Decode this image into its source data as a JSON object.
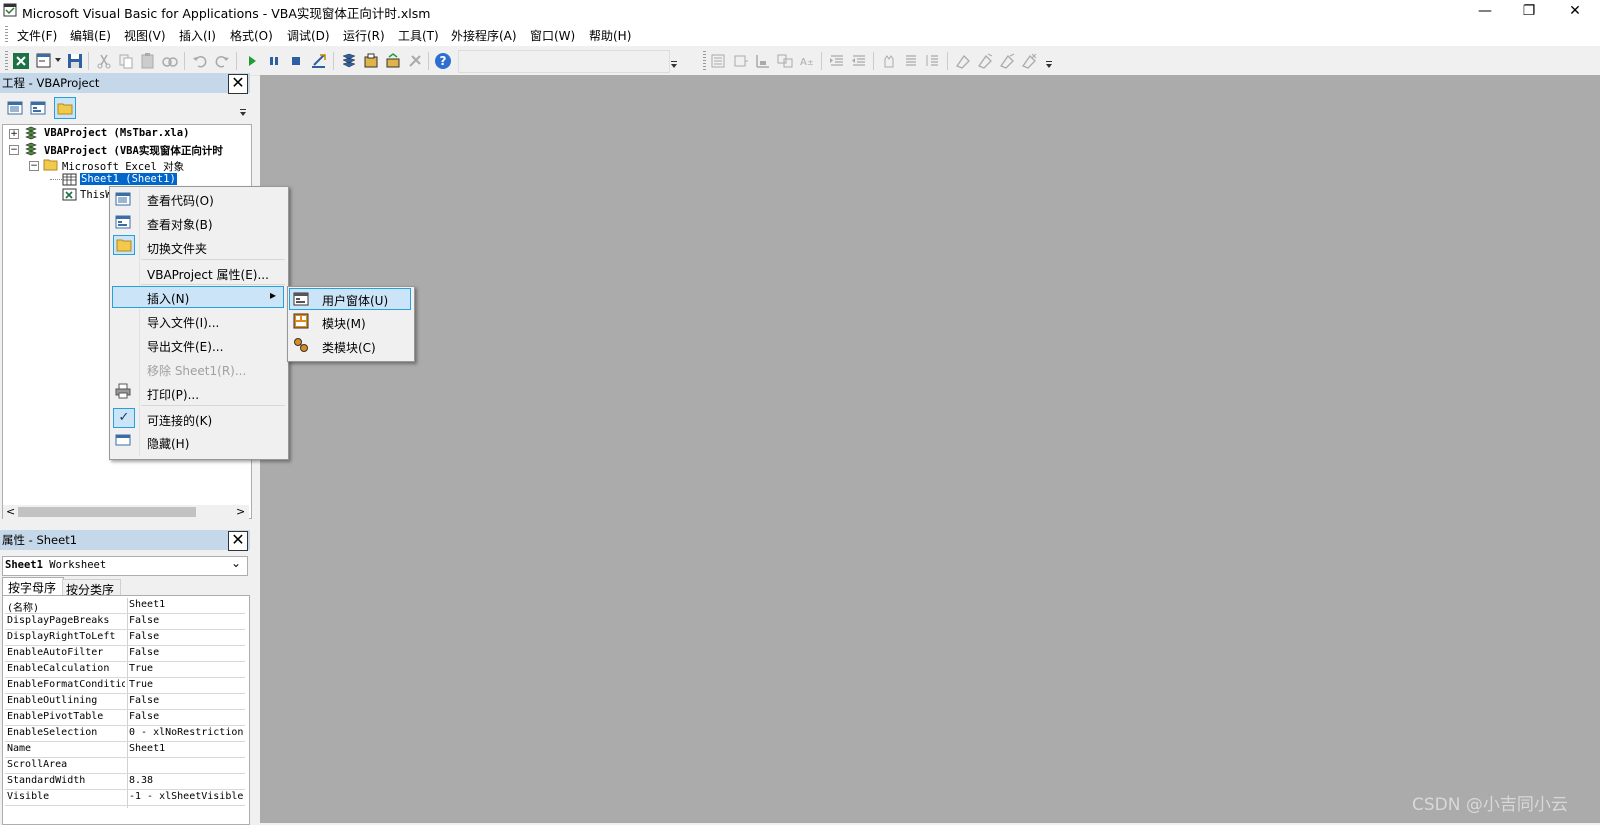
{
  "window": {
    "title": "Microsoft Visual Basic for Applications - VBA实现窗体正向计时.xlsm",
    "minimize": "—",
    "restore": "❐",
    "close": "✕"
  },
  "menu": [
    "文件(F)",
    "编辑(E)",
    "视图(V)",
    "插入(I)",
    "格式(O)",
    "调试(D)",
    "运行(R)",
    "工具(T)",
    "外接程序(A)",
    "窗口(W)",
    "帮助(H)"
  ],
  "project_panel": {
    "title": "工程 - VBAProject",
    "close": "✕",
    "nodes": {
      "n1": "VBAProject (MsTbar.xla)",
      "n2": "VBAProject (VBA实现窗体正向计时",
      "n3": "Microsoft Excel 对象",
      "n4": "Sheet1 (Sheet1)",
      "n5": "ThisW"
    },
    "expand_plus": "+",
    "expand_minus": "−"
  },
  "context_menu": {
    "items": {
      "view_code": "查看代码(O)",
      "view_object": "查看对象(B)",
      "toggle_folders": "切换文件夹",
      "project_properties": "VBAProject 属性(E)...",
      "insert": "插入(N)",
      "import": "导入文件(I)...",
      "export": "导出文件(E)...",
      "remove": "移除 Sheet1(R)...",
      "print": "打印(P)...",
      "dockable": "可连接的(K)",
      "hide": "隐藏(H)"
    },
    "submenu_arrow": "▸",
    "checkmark": "✓"
  },
  "submenu": {
    "userform": "用户窗体(U)",
    "module": "模块(M)",
    "class_module": "类模块(C)"
  },
  "properties_panel": {
    "title": "属性 - Sheet1",
    "close": "✕",
    "object_selector_bold": "Sheet1",
    "object_selector_type": " Worksheet",
    "dropdown_arrow": "⌄",
    "tabs": [
      "按字母序",
      "按分类序"
    ],
    "rows": [
      {
        "key": "(名称)",
        "value": "Sheet1"
      },
      {
        "key": "DisplayPageBreaks",
        "value": "False"
      },
      {
        "key": "DisplayRightToLeft",
        "value": "False"
      },
      {
        "key": "EnableAutoFilter",
        "value": "False"
      },
      {
        "key": "EnableCalculation",
        "value": "True"
      },
      {
        "key": "EnableFormatConditio",
        "value": "True"
      },
      {
        "key": "EnableOutlining",
        "value": "False"
      },
      {
        "key": "EnablePivotTable",
        "value": "False"
      },
      {
        "key": "EnableSelection",
        "value": "0 - xlNoRestriction"
      },
      {
        "key": "Name",
        "value": "Sheet1"
      },
      {
        "key": "ScrollArea",
        "value": ""
      },
      {
        "key": "StandardWidth",
        "value": "8.38"
      },
      {
        "key": "Visible",
        "value": "-1 - xlSheetVisible"
      }
    ]
  },
  "scroll_left": "<",
  "scroll_right": ">",
  "watermark": "CSDN @小吉同小云",
  "colors": {
    "panel_title": "#c5d8ea",
    "selection": "#cce4f7",
    "selection_border": "#26a0da",
    "workspace": "#ababab",
    "tree_selected": "#0066cc"
  }
}
